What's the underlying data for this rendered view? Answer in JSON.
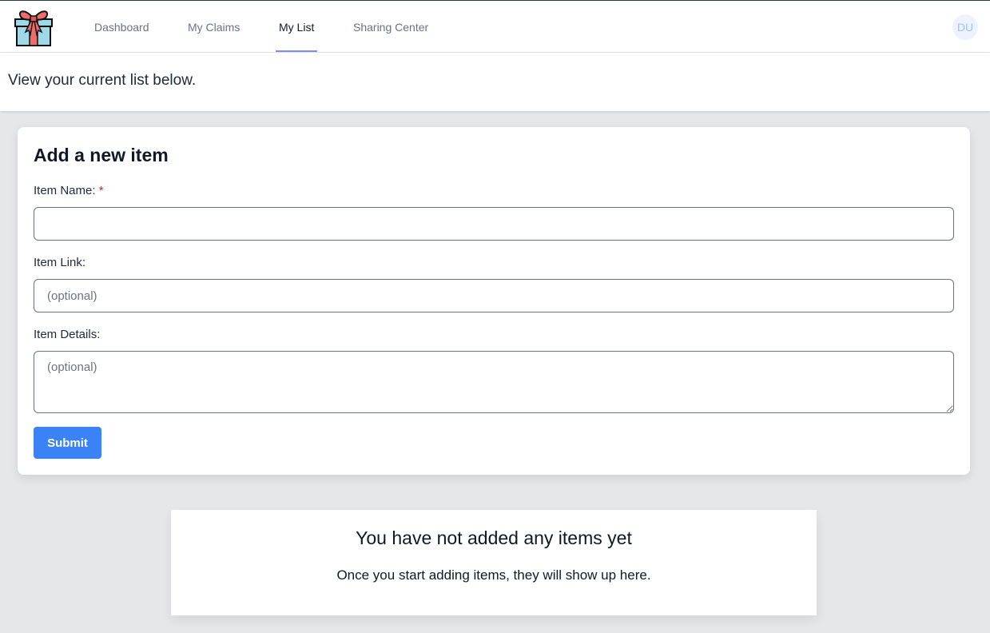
{
  "nav": {
    "logo_icon": "gift-icon",
    "items": [
      {
        "label": "Dashboard"
      },
      {
        "label": "My Claims"
      },
      {
        "label": "My List"
      },
      {
        "label": "Sharing Center"
      }
    ],
    "active_item": "My List",
    "avatar": "DU"
  },
  "subheader": {
    "text": "View your current list below."
  },
  "form": {
    "title": "Add a new item",
    "item_name": {
      "label": "Item Name:",
      "required_marker": "*",
      "value": "",
      "placeholder": ""
    },
    "item_link": {
      "label": "Item Link:",
      "value": "",
      "placeholder": "(optional)"
    },
    "item_details": {
      "label": "Item Details:",
      "value": "",
      "placeholder": "(optional)"
    },
    "submit_label": "Submit"
  },
  "empty_state": {
    "title": "You have not added any items yet",
    "text": "Once you start adding items, they will show up here."
  },
  "colors": {
    "accent": "#3b82f6",
    "active_underline": "#818cf8",
    "required": "#dc2626",
    "background": "#e5e7eb"
  }
}
